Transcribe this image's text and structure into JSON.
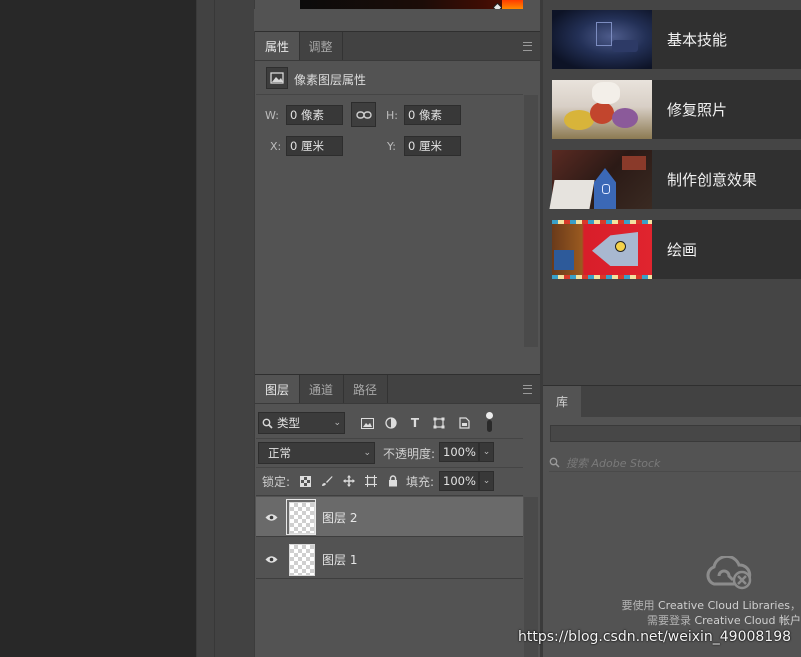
{
  "properties_panel": {
    "tabs": [
      {
        "label": "属性"
      },
      {
        "label": "调整"
      }
    ],
    "header": {
      "icon": "image-layer-icon",
      "title": "像素图层属性"
    },
    "w_label": "W:",
    "w_value": "0 像素",
    "h_label": "H:",
    "h_value": "0 像素",
    "x_label": "X:",
    "x_value": "0 厘米",
    "y_label": "Y:",
    "y_value": "0 厘米",
    "link_icon": "chain-link-icon"
  },
  "layers_panel": {
    "tabs": [
      {
        "label": "图层"
      },
      {
        "label": "通道"
      },
      {
        "label": "路径"
      }
    ],
    "filter": {
      "value": "类型",
      "icon": "search-icon"
    },
    "blend_mode": "正常",
    "opacity_label": "不透明度:",
    "opacity_value": "100%",
    "lock_label": "锁定:",
    "fill_label": "填充:",
    "fill_value": "100%",
    "layers": [
      {
        "name": "图层 2",
        "selected": true,
        "visible": true
      },
      {
        "name": "图层 1",
        "selected": false,
        "visible": true
      }
    ]
  },
  "learn_panel": {
    "items": [
      {
        "title": "基本技能",
        "thumb": "dark-room"
      },
      {
        "title": "修复照片",
        "thumb": "flowers"
      },
      {
        "title": "制作创意效果",
        "thumb": "pencil"
      },
      {
        "title": "绘画",
        "thumb": "fish"
      }
    ]
  },
  "library_panel": {
    "tab": "库",
    "search_placeholder": "搜索 Adobe Stock",
    "cc_line1_prefix": "要使用 ",
    "cc_line1_brand": "Creative Cloud Libraries",
    "cc_line1_suffix": "，",
    "cc_line2_prefix": "需要登录 ",
    "cc_line2_brand": "Creative Cloud 帐户",
    "cc_icon": "creative-cloud-disconnected-icon"
  },
  "watermark": "https://blog.csdn.net/weixin_49008198",
  "colors": {
    "accent_selected_row": "#6a6a6a",
    "panel_bg": "#535353",
    "canvas_bg": "#282828"
  }
}
